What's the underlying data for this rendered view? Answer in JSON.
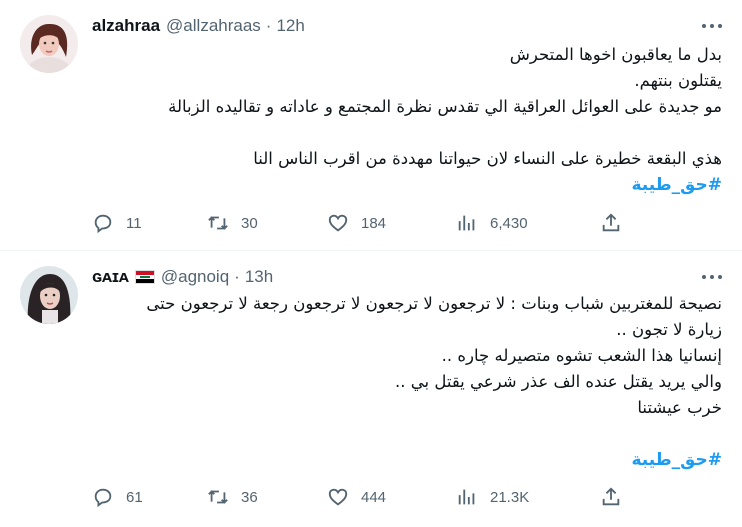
{
  "tweets": [
    {
      "author": {
        "name": "alzahraa",
        "handle": "@allzahraas",
        "separator": "·",
        "time": "12h"
      },
      "lines": [
        "بدل ما يعاقبون اخوها المتحرش",
        "يقتلون بنتهم.",
        "مو جديدة على العوائل العراقية الي تقدس نظرة المجتمع و عاداته و تقاليده الزبالة",
        "",
        "هذي البقعة خطيرة على النساء لان حيواتنا مهددة من اقرب الناس النا"
      ],
      "hashtag": "#حق_طيبة",
      "stats": {
        "replies": "11",
        "retweets": "30",
        "likes": "184",
        "views": "6,430"
      }
    },
    {
      "author": {
        "name": "ɢᴀɪᴀ",
        "flag": "iraq-flag",
        "handle": "@agnoiq",
        "separator": "·",
        "time": "13h"
      },
      "lines": [
        "نصيحة للمغتربين شباب وبنات : لا ترجعون لا ترجعون لا ترجعون رجعة لا ترجعون حتى",
        "زيارة لا تجون ..",
        "إنسانيا هذا الشعب تشوه متصيرله چاره ..",
        "والي يريد يقتل عنده الف عذر شرعي يقتل بي ..",
        "خرب عيشتنا",
        ""
      ],
      "hashtag": "#حق_طيبة",
      "stats": {
        "replies": "61",
        "retweets": "36",
        "likes": "444",
        "views": "21.3K"
      }
    }
  ],
  "icons": {
    "reply": "reply-icon",
    "retweet": "retweet-icon",
    "like": "heart-icon",
    "views": "views-icon",
    "share": "share-icon",
    "more": "more-options-icon"
  },
  "colors": {
    "text": "#0f1419",
    "secondary": "#536471",
    "hashtag": "#1d9bf0",
    "divider": "#eff3f4"
  }
}
